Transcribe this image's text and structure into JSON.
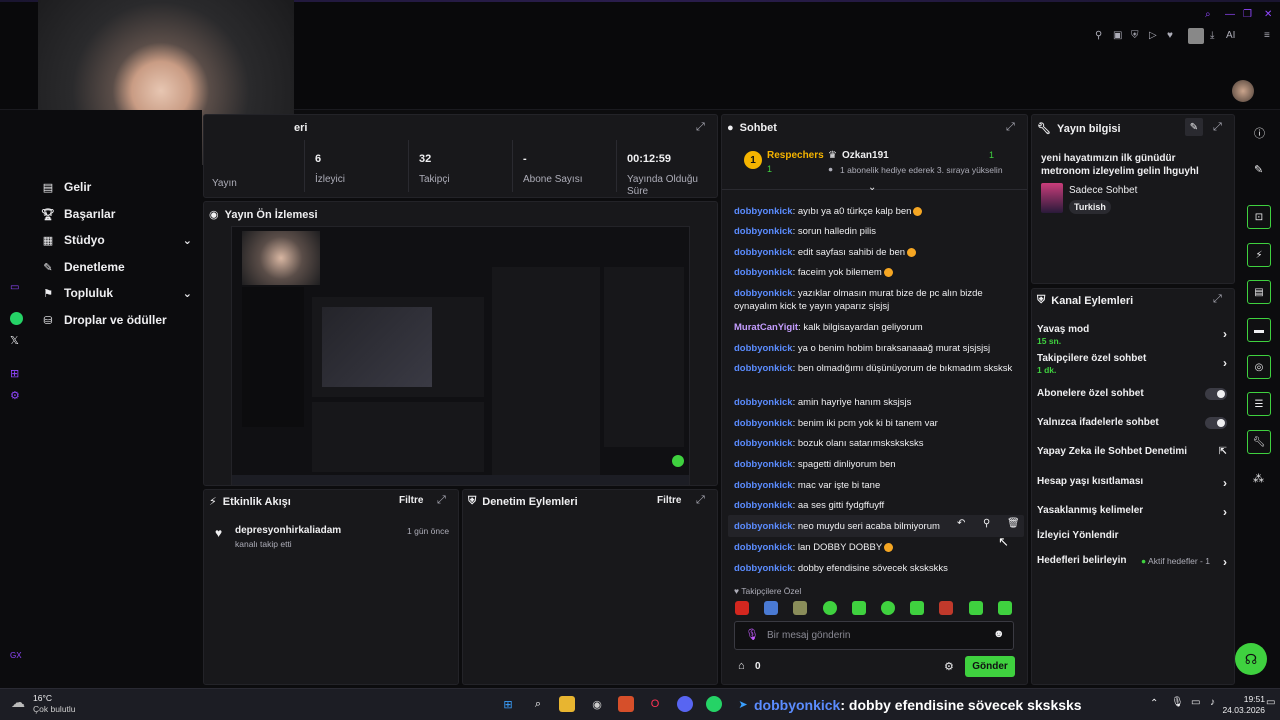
{
  "colors": {
    "accent": "#3fd13f",
    "brand_purple": "#9147ff",
    "username": "#5b8cff",
    "username_alt": "#c49dff"
  },
  "top": {
    "ai_label": "AI"
  },
  "sidebar": {
    "items": [
      {
        "label": "Gelir",
        "icon": "revenue-icon"
      },
      {
        "label": "Başarılar",
        "icon": "trophy-icon"
      },
      {
        "label": "Stüdyo",
        "icon": "studio-icon",
        "expandable": true
      },
      {
        "label": "Denetleme",
        "icon": "moderation-icon"
      },
      {
        "label": "Topluluk",
        "icon": "community-icon",
        "expandable": true
      },
      {
        "label": "Droplar ve ödüller",
        "icon": "drops-icon"
      }
    ],
    "footer": "GX"
  },
  "stats": {
    "title_partial": "eri",
    "items": [
      {
        "value": "",
        "label": "Yayın"
      },
      {
        "value": "6",
        "label": "İzleyici"
      },
      {
        "value": "32",
        "label": "Takipçi"
      },
      {
        "value": "-",
        "label": "Abone Sayısı"
      },
      {
        "value": "00:12:59",
        "label": "Yayında Olduğu Süre"
      }
    ]
  },
  "preview": {
    "title": "Yayın Ön İzlemesi"
  },
  "activity": {
    "title": "Etkinlik Akışı",
    "filter": "Filtre",
    "event_user": "depresyonhirkaliadam",
    "event_desc": "kanalı takip etti",
    "event_time": "1 gün önce"
  },
  "mod_actions": {
    "title": "Denetim Eylemleri",
    "filter": "Filtre"
  },
  "chat": {
    "title": "Sohbet",
    "leader_rank": "1",
    "leader_name": "Respechers",
    "leader_count": "1",
    "gifter_name": "Ozkan191",
    "gifter_count": "1",
    "gifter_text": "1 abonelik hediye ederek 3. sıraya yükselin",
    "messages": [
      {
        "user": "dobbyonkick",
        "text": "ayıbı ya a0 türkçe kalp ben"
      },
      {
        "user": "dobbyonkick",
        "text": "sorun halledin pilis"
      },
      {
        "user": "dobbyonkick",
        "text": "edit sayfası sahibi de ben"
      },
      {
        "user": "dobbyonkick",
        "text": "faceim yok bilemem"
      },
      {
        "user": "dobbyonkick",
        "text": "yazıklar olmasın murat bize de pc alın bizde oynayalım kick te yayın yaparız sjsjsj"
      },
      {
        "user": "MuratCanYigit",
        "text": "kalk bilgisayardan geliyorum"
      },
      {
        "user": "dobbyonkick",
        "text": "ya o benim hobim bıraksanaaağ murat sjsjsjsj"
      },
      {
        "user": "dobbyonkick",
        "text": "ben olmadığımı düşünüyorum  de bıkmadım sksksk"
      },
      {
        "user": "dobbyonkick",
        "text": "amin hayriye hanım sksjsjs"
      },
      {
        "user": "dobbyonkick",
        "text": "benim iki pcm yok ki bi tanem var"
      },
      {
        "user": "dobbyonkick",
        "text": "bozuk olanı satarımsksksksks"
      },
      {
        "user": "dobbyonkick",
        "text": "spagetti dinliyorum ben"
      },
      {
        "user": "dobbyonkick",
        "text": "mac var işte bi tane"
      },
      {
        "user": "dobbyonkick",
        "text": "aa ses gitti fydgffuyff"
      },
      {
        "user": "dobbyonkick",
        "text": "neo muydu seri acaba bilmiyorum"
      },
      {
        "user": "dobbyonkick",
        "text": "lan DOBBY DOBBY"
      },
      {
        "user": "dobbyonkick",
        "text": "dobby efendisine sövecek skskskks"
      }
    ],
    "followers_only": "Takipçilere Özel",
    "input_placeholder": "Bir mesaj gönderin",
    "points": "0",
    "send_label": "Gönder"
  },
  "stream_info": {
    "title": "Yayın bilgisi",
    "stream_title": "yeni hayatımızın ilk günüdür metronom izleyelim gelin lhguyhl",
    "category": "Sadece Sohbet",
    "tag": "Turkish"
  },
  "channel_actions": {
    "title": "Kanal Eylemleri",
    "slow_mode": "Yavaş mod",
    "slow_mode_value": "15 sn.",
    "followers_chat": "Takipçilere özel sohbet",
    "followers_chat_value": "1 dk.",
    "subs_chat": "Abonelere özel sohbet",
    "emotes_chat": "Yalnızca ifadelerle sohbet",
    "ai_mod": "Yapay Zeka ile Sohbet Denetimi",
    "account_age": "Hesap yaşı kısıtlaması",
    "banned_words": "Yasaklanmış kelimeler",
    "viewer_redirect": "İzleyici Yönlendir",
    "set_goals": "Hedefleri belirleyin",
    "active_goals": "Aktif hedefler - 1"
  },
  "taskbar": {
    "temp": "16°C",
    "weather": "Çok bulutlu",
    "overlay_user": "dobbyonkick",
    "overlay_text": ": dobby efendisine sövecek sksksks",
    "time": "19:51",
    "date": "24.03.2026"
  }
}
